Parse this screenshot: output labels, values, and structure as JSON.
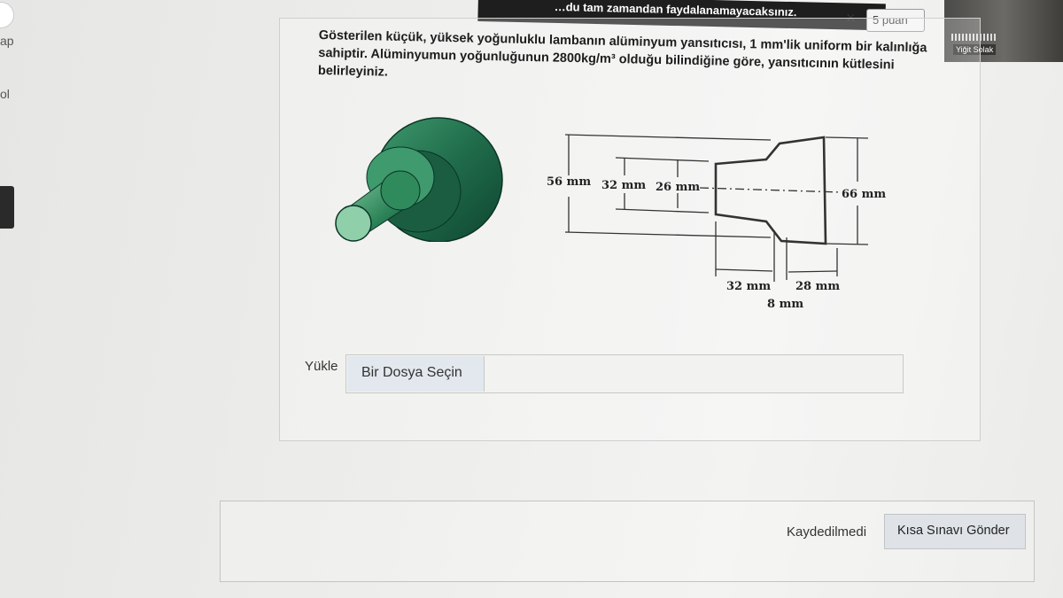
{
  "banner": {
    "text": "…du tam zamandan faydalanamayacaksınız."
  },
  "side_fragments": [
    "ap",
    "ol"
  ],
  "points": {
    "close_symbol": "×",
    "label": "5 puan"
  },
  "video": {
    "name": "Yiğit Solak"
  },
  "question": {
    "text": "Gösterilen küçük, yüksek yoğunluklu lambanın alüminyum yansıtıcısı, 1 mm'lik uniform bir kalınlığa sahiptir. Alüminyumun yoğunluğunun 2800kg/m³ olduğu bilindiğine göre, yansıtıcının kütlesini belirleyiniz."
  },
  "figure": {
    "color": "#1f6b4a",
    "dims": {
      "d56": "56 mm",
      "d32": "32 mm",
      "d26": "26 mm",
      "d66": "66 mm",
      "l32": "32 mm",
      "l28": "28 mm",
      "l8": "8 mm"
    }
  },
  "upload": {
    "label": "Yükle",
    "button": "Bir Dosya Seçin"
  },
  "footer": {
    "status": "Kaydedilmedi",
    "submit": "Kısa Sınavı Gönder"
  },
  "colors": {
    "accent_button": "#e2e8ee",
    "text": "#222222"
  }
}
